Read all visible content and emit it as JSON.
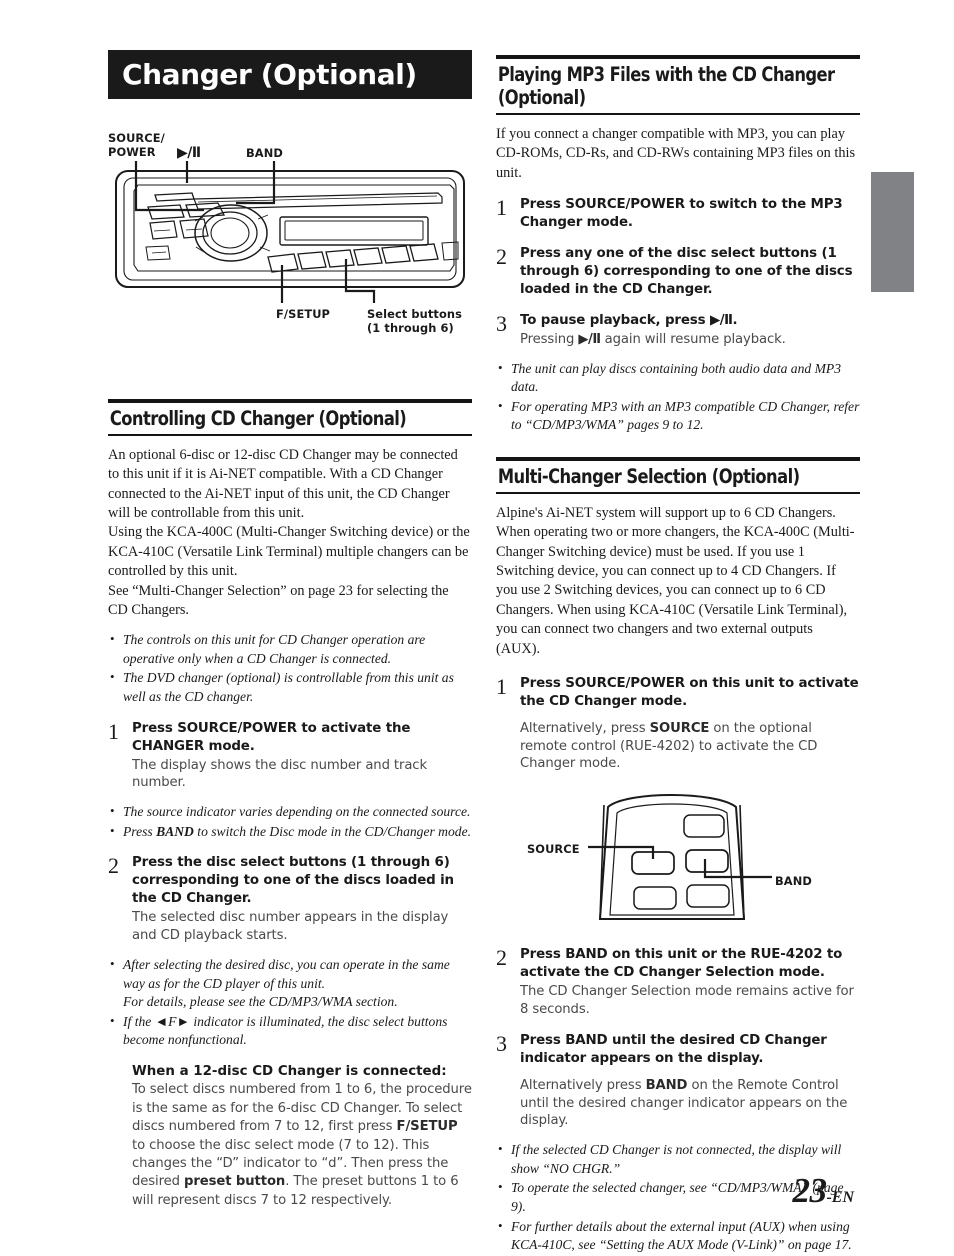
{
  "chapter": {
    "title": "Changer (Optional)"
  },
  "head_unit_diagram": {
    "labels": {
      "source_power": "SOURCE/\nPOWER",
      "play_pause": "▶/Ⅱ",
      "band": "BAND",
      "f_setup": "F/SETUP",
      "select_buttons": "Select buttons\n(1 through 6)"
    }
  },
  "remote_diagram": {
    "labels": {
      "source": "SOURCE",
      "band": "BAND"
    }
  },
  "left_column": {
    "section1": {
      "heading": "Controlling CD Changer (Optional)",
      "paragraphs": [
        "An optional 6-disc or 12-disc CD Changer may be connected to this unit if it is Ai-NET compatible. With a CD Changer connected to the Ai-NET input of this unit, the CD Changer will be controllable from this unit.",
        "Using the KCA-400C (Multi-Changer Switching device) or the KCA-410C (Versatile Link Terminal) multiple changers can be controlled by this unit.",
        "See “Multi-Changer Selection” on page 23 for selecting the CD Changers."
      ],
      "notes_a": [
        "The controls on this unit for CD Changer operation are operative only when a CD Changer is connected.",
        "The DVD changer (optional) is controllable from this unit as well as the CD changer."
      ],
      "step1": {
        "number": "1",
        "title_pre": "Press ",
        "title_bold": "SOURCE/POWER",
        "title_post": " to activate the CHANGER mode.",
        "sub": "The display shows the disc number and track number."
      },
      "notes_b": [
        "The source indicator varies depending on the connected source.",
        "Press BAND to switch the Disc mode in the CD/Changer mode."
      ],
      "step2": {
        "number": "2",
        "title_pre": "Press the disc ",
        "title_bold": "select buttons (1 through 6)",
        "title_post": " corresponding to one of the discs loaded in the CD Changer.",
        "sub": "The selected disc number appears in the display and CD playback starts."
      },
      "notes_c": [
        "After selecting the desired disc, you can operate in the same way as for the CD player of this unit.\nFor details, please see the CD/MP3/WMA section.",
        "If the ◄F► indicator is illuminated, the disc select buttons become nonfunctional."
      ],
      "subblock": {
        "heading": "When a 12-disc CD Changer is connected:",
        "text_1": "To select discs numbered from 1 to 6, the procedure is the same as for the 6-disc CD Changer. To select discs numbered from 7 to 12, first press ",
        "text_b1": "F/SETUP",
        "text_2": " to choose the disc select mode (7 to 12). This changes the “D” indicator to “d”. Then press the desired ",
        "text_b2": "preset button",
        "text_3": ". The preset buttons 1 to 6 will represent discs 7 to 12 respectively."
      }
    }
  },
  "right_column": {
    "section2": {
      "heading": "Playing MP3 Files with the CD Changer (Optional)",
      "intro": "If you connect a changer compatible with MP3, you can play CD-ROMs, CD-Rs, and CD-RWs containing MP3 files on this unit.",
      "step1": {
        "number": "1",
        "title_pre": "Press ",
        "title_bold": "SOURCE/POWER",
        "title_post": " to switch to the MP3 Changer mode."
      },
      "step2": {
        "number": "2",
        "title_pre": "Press any one of the disc ",
        "title_bold": "select buttons (1 through 6)",
        "title_post": " corresponding to one of the discs loaded in the CD Changer."
      },
      "step3": {
        "number": "3",
        "title_pre": "To pause playback, press ",
        "title_bold": "▶/Ⅱ",
        "title_post": ".",
        "sub_pre": "Pressing ",
        "sub_bold": "▶/Ⅱ",
        "sub_post": " again will resume playback."
      },
      "notes": [
        "The unit can play discs containing both audio data and MP3 data.",
        "For operating MP3 with an MP3 compatible CD Changer, refer to “CD/MP3/WMA” pages 9 to 12."
      ]
    },
    "section3": {
      "heading": "Multi-Changer Selection (Optional)",
      "intro": "Alpine's Ai-NET system will support up to 6 CD Changers. When operating two or more changers, the KCA-400C (Multi-Changer Switching device) must be used. If you use 1 Switching device, you can connect up to 4 CD Changers. If you use 2 Switching devices, you can connect up to 6 CD Changers. When using KCA-410C (Versatile Link Terminal), you can connect two changers and two external outputs (AUX).",
      "step1": {
        "number": "1",
        "title_pre": "Press ",
        "title_bold": "SOURCE/POWER",
        "title_post": " on this unit to activate the CD Changer mode.",
        "sub_pre": "Alternatively, press ",
        "sub_bold": "SOURCE",
        "sub_post": " on the optional remote control (RUE-4202) to activate the CD Changer mode."
      },
      "step2": {
        "number": "2",
        "title_pre": "Press ",
        "title_bold": "BAND",
        "title_post": " on this unit or the RUE-4202 to activate the CD Changer Selection mode.",
        "sub": "The CD Changer Selection mode remains active for 8 seconds."
      },
      "step3": {
        "number": "3",
        "title_pre": "Press ",
        "title_bold": "BAND",
        "title_post": " until the desired CD Changer indicator appears on the display.",
        "sub_pre": "Alternatively press ",
        "sub_bold": "BAND",
        "sub_post": " on the Remote Control until the desired changer indicator appears on the display."
      },
      "notes": [
        "If the selected CD Changer is not connected, the display will show “NO CHGR.”",
        "To operate the selected changer, see “CD/MP3/WMA” (page 9).",
        "For further details about the external input (AUX) when using KCA-410C, see “Setting the AUX Mode (V-Link)” on page 17."
      ]
    }
  },
  "footer": {
    "page_number": "23",
    "page_suffix": "-EN"
  },
  "colors": {
    "band_bg": "#1a1a1a",
    "rule": "#141414",
    "thumb_tab": "#808286",
    "body_text": "#1a1a1a",
    "sub_text": "#4a4a4a"
  }
}
